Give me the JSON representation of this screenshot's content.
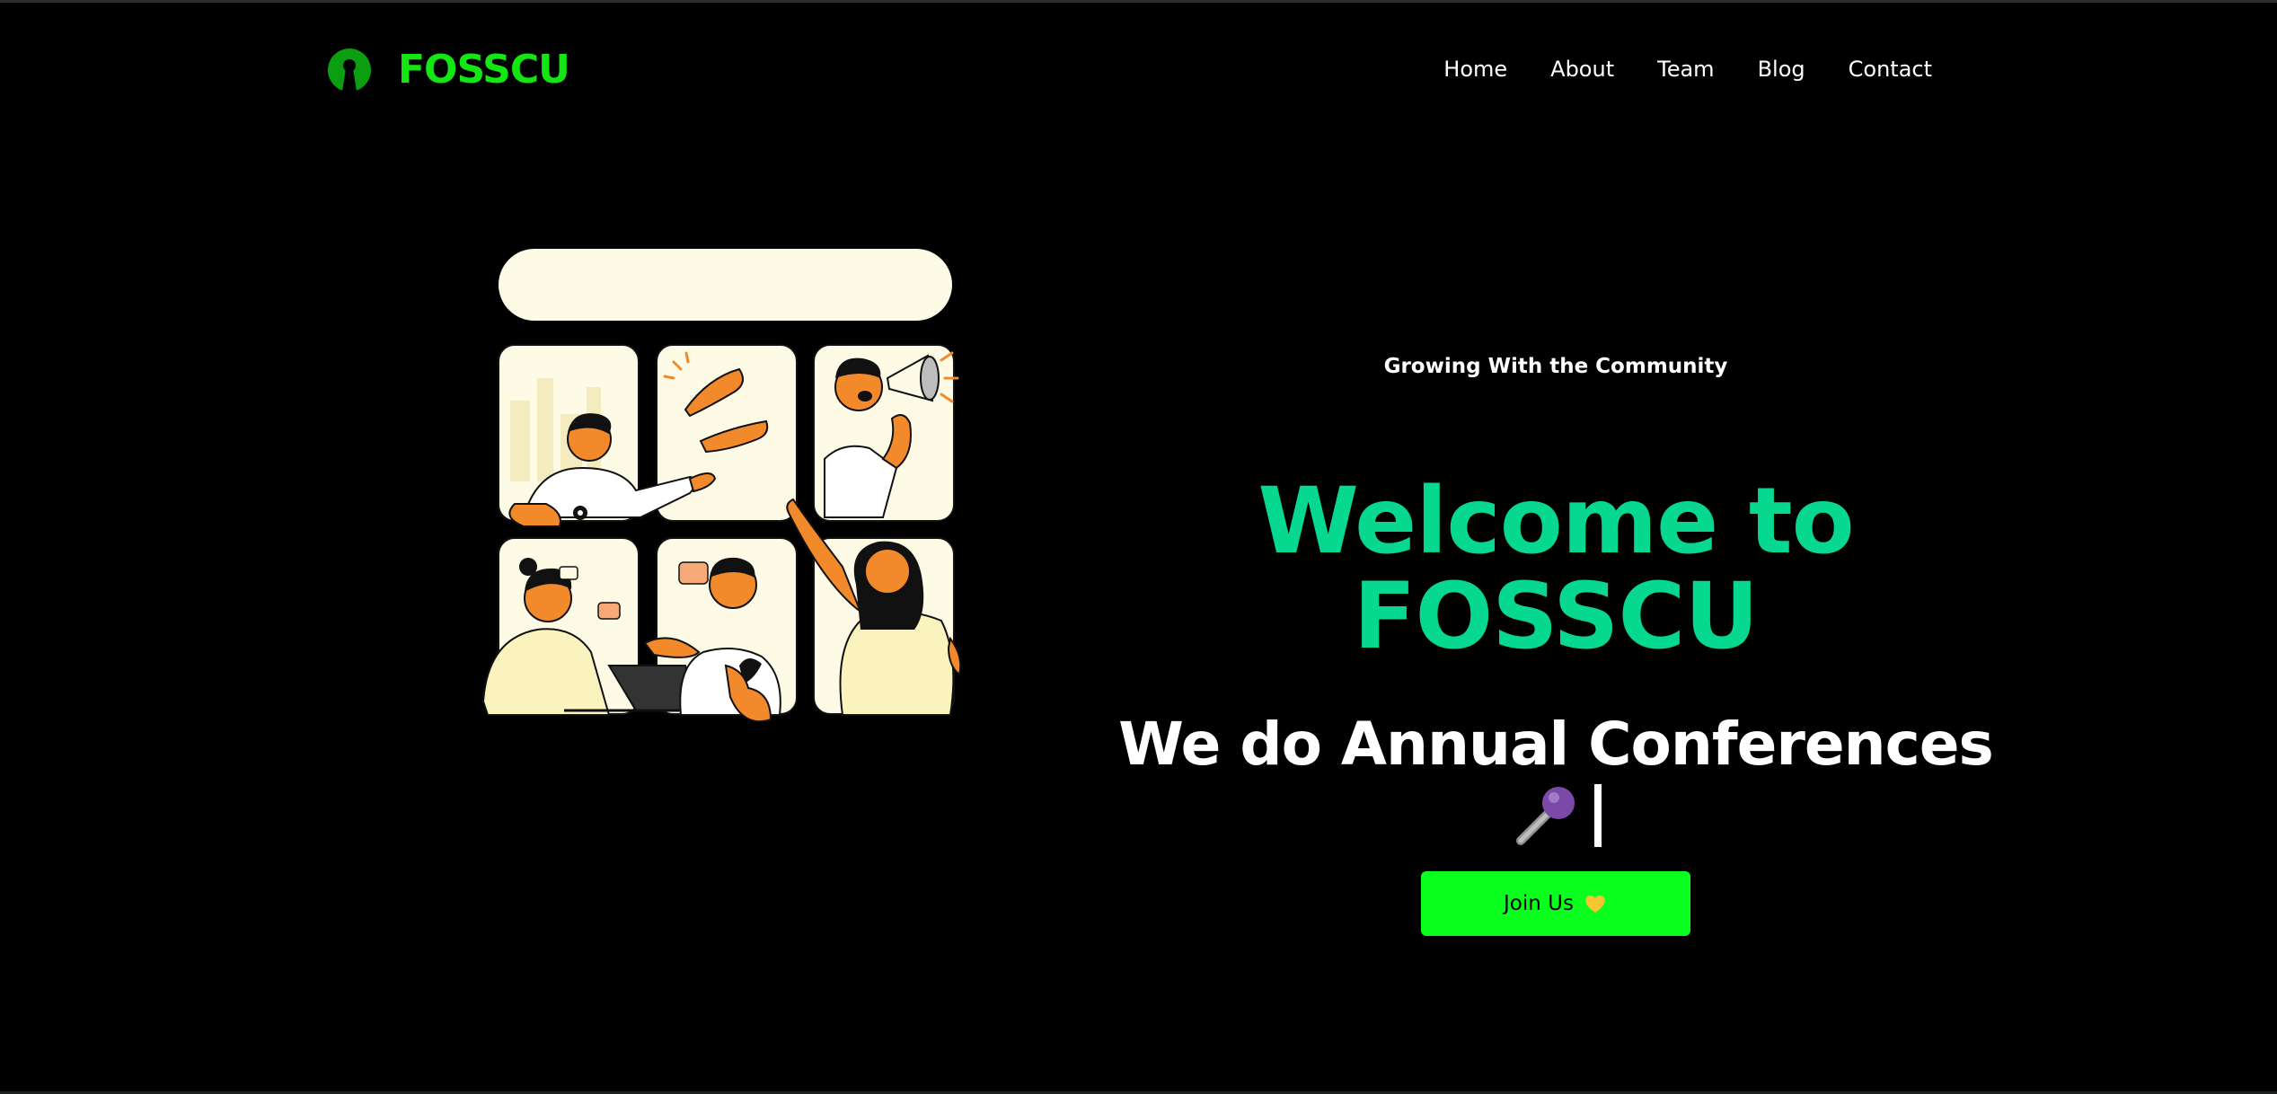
{
  "brand": {
    "name": "FOSSCU",
    "logo_icon": "open-source-keyhole-icon",
    "color": "#14e614"
  },
  "nav": {
    "items": [
      {
        "label": "Home"
      },
      {
        "label": "About"
      },
      {
        "label": "Team"
      },
      {
        "label": "Blog"
      },
      {
        "label": "Contact"
      }
    ]
  },
  "hero": {
    "tagline": "Growing With the Community",
    "title_line1": "Welcome to",
    "title_line2": "FOSSCU",
    "title_color": "#06d88f",
    "typewriter_text": "We do Annual Conferences",
    "typewriter_icon": "microphone-icon",
    "cta": {
      "label": "Join Us",
      "icon": "yellow-heart-icon",
      "color": "#0aff1e"
    }
  },
  "illustration": {
    "icon": "community-people-grid-illustration"
  }
}
